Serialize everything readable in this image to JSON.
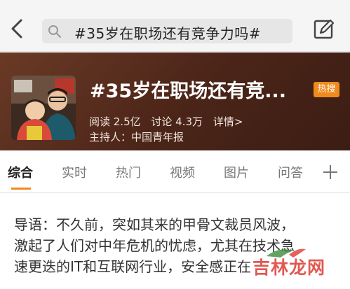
{
  "search": {
    "query": "#35岁在职场还有竞争力吗#"
  },
  "topic": {
    "title": "#35岁在职场还有竞...",
    "badge": "热搜",
    "stats": {
      "reads": "阅读 2.5亿",
      "discussions": "讨论 4.3万",
      "details": "详情>"
    },
    "host": "主持人：中国青年报"
  },
  "tabs": [
    {
      "label": "综合",
      "active": true
    },
    {
      "label": "实时"
    },
    {
      "label": "热门"
    },
    {
      "label": "视频"
    },
    {
      "label": "图片"
    },
    {
      "label": "问答"
    }
  ],
  "intro": {
    "line1": "导语：不久前，突如其来的甲骨文裁员风波，",
    "line2": "激起了人们对中年危机的忧虑，尤其在技术急",
    "line3": "速更迭的IT和互联网行业，安全感正在"
  },
  "watermark": "吉林龙网",
  "colors": {
    "accent": "#f08a1c",
    "header_bg": "#4a2418",
    "watermark": "#dc3c32"
  },
  "icons": [
    "back-arrow-icon",
    "search-icon",
    "compose-icon",
    "plus-icon"
  ]
}
